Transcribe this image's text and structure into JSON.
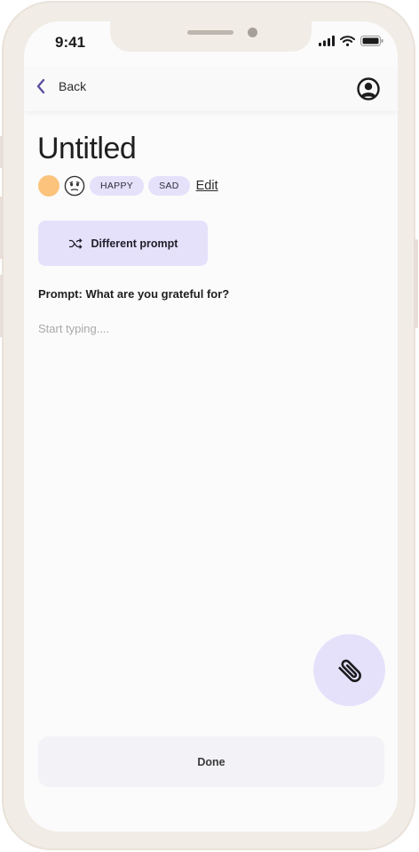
{
  "status_bar": {
    "time": "9:41"
  },
  "nav": {
    "back_label": "Back"
  },
  "entry": {
    "title": "Untitled",
    "mood_color": "#fbc37c",
    "tags": [
      "HAPPY",
      "SAD"
    ],
    "edit_label": "Edit"
  },
  "prompt": {
    "button_label": "Different prompt",
    "text": "Prompt: What are you grateful for?"
  },
  "editor": {
    "placeholder": "Start typing...."
  },
  "actions": {
    "done_label": "Done"
  },
  "colors": {
    "accent_light": "#e6e1fb",
    "back_chevron": "#5a4fa0",
    "frame": "#f1ece6"
  },
  "icons": [
    "chevron-left-icon",
    "user-circle-icon",
    "neutral-face-icon",
    "shuffle-icon",
    "paperclip-icon"
  ]
}
